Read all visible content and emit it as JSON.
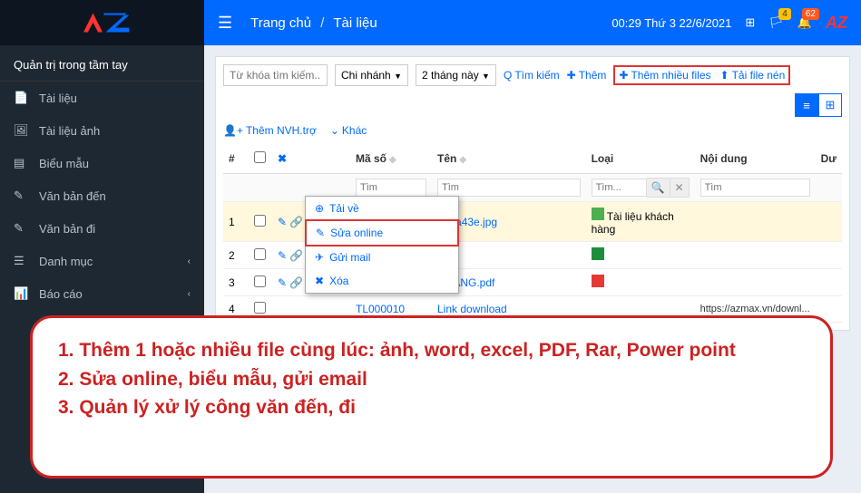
{
  "header": {
    "datetime": "00:29  Thứ 3 22/6/2021",
    "breadcrumb_home": "Trang chủ",
    "breadcrumb_current": "Tài liệu",
    "notif_count1": "4",
    "notif_count2": "62"
  },
  "sidebar": {
    "title": "Quản trị trong tầm tay",
    "items": [
      {
        "label": "Tài liệu",
        "icon": "document-icon"
      },
      {
        "label": "Tài liệu ảnh",
        "icon": "image-icon"
      },
      {
        "label": "Biểu mẫu",
        "icon": "form-icon"
      },
      {
        "label": "Văn bản đến",
        "icon": "inbox-icon"
      },
      {
        "label": "Văn bản đi",
        "icon": "outbox-icon"
      },
      {
        "label": "Danh mục",
        "icon": "list-icon",
        "chevron": true
      },
      {
        "label": "Báo cáo",
        "icon": "chart-icon",
        "chevron": true
      }
    ]
  },
  "toolbar": {
    "search_placeholder": "Từ khóa tìm kiếm...",
    "branch_label": "Chi nhánh",
    "period_label": "2 tháng này",
    "btn_search": "Tìm kiếm",
    "btn_add": "Thêm",
    "btn_add_multi": "Thêm nhiều files",
    "btn_add_zip": "Tải file nén",
    "btn_add_nvh": "Thêm NVH.trợ",
    "btn_other": "Khác"
  },
  "table": {
    "columns": {
      "num": "#",
      "code": "Mã số",
      "name": "Tên",
      "type": "Loại",
      "content": "Nội dung",
      "du": "Dư"
    },
    "filter_placeholder": "Tìm",
    "filter_type_placeholder": "Tìm...",
    "rows": [
      {
        "num": "1",
        "name_fragment": "d71a43e.jpg",
        "type": "Tài liệu khách hàng",
        "icon": "img"
      },
      {
        "num": "2",
        "icon": "xls"
      },
      {
        "num": "3",
        "name_fragment": "NHANG.pdf",
        "icon": "pdf"
      },
      {
        "num": "4",
        "code": "TL000010",
        "name": "Link download",
        "content": "https://azmax.vn/downl..."
      }
    ]
  },
  "context_menu": {
    "download": "Tải về",
    "edit_online": "Sửa online",
    "send_mail": "Gửi mail",
    "delete": "Xóa"
  },
  "callout": {
    "line1": "1. Thêm 1 hoặc nhiều file cùng lúc: ảnh, word, excel, PDF, Rar, Power point",
    "line2": "2. Sửa online, biểu mẫu, gửi email",
    "line3": "3. Quản lý xử lý công văn đến, đi"
  }
}
